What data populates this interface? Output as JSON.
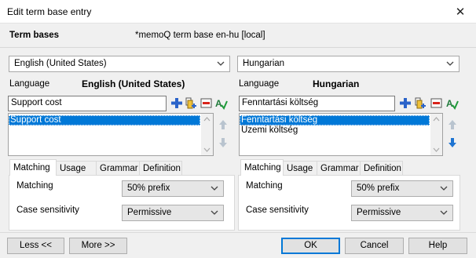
{
  "window": {
    "title": "Edit term base entry",
    "close_glyph": "✕"
  },
  "termbases": {
    "label": "Term bases",
    "value": "*memoQ term base en-hu [local]"
  },
  "left": {
    "language_select": "English (United States)",
    "language_label": "Language",
    "language_name": "English (United States)",
    "term_input": "Support cost",
    "terms": [
      "Support cost"
    ],
    "tabs": [
      "Matching",
      "Usage",
      "Grammar",
      "Definition"
    ],
    "matching_label": "Matching",
    "matching_value": "50% prefix",
    "case_label": "Case sensitivity",
    "case_value": "Permissive"
  },
  "right": {
    "language_select": "Hungarian",
    "language_label": "Language",
    "language_name": "Hungarian",
    "term_input": "Fenntartási költség",
    "terms": [
      "Fenntartási költség",
      "Üzemi költség"
    ],
    "tabs": [
      "Matching",
      "Usage",
      "Grammar",
      "Definition"
    ],
    "matching_label": "Matching",
    "matching_value": "50% prefix",
    "case_label": "Case sensitivity",
    "case_value": "Permissive"
  },
  "buttons": {
    "less": "Less <<",
    "more": "More >>",
    "ok": "OK",
    "cancel": "Cancel",
    "help": "Help"
  },
  "colors": {
    "selection": "#0078d7",
    "accent_arrow": "#1e74d2",
    "disabled_arrow": "#b9c4cf"
  }
}
